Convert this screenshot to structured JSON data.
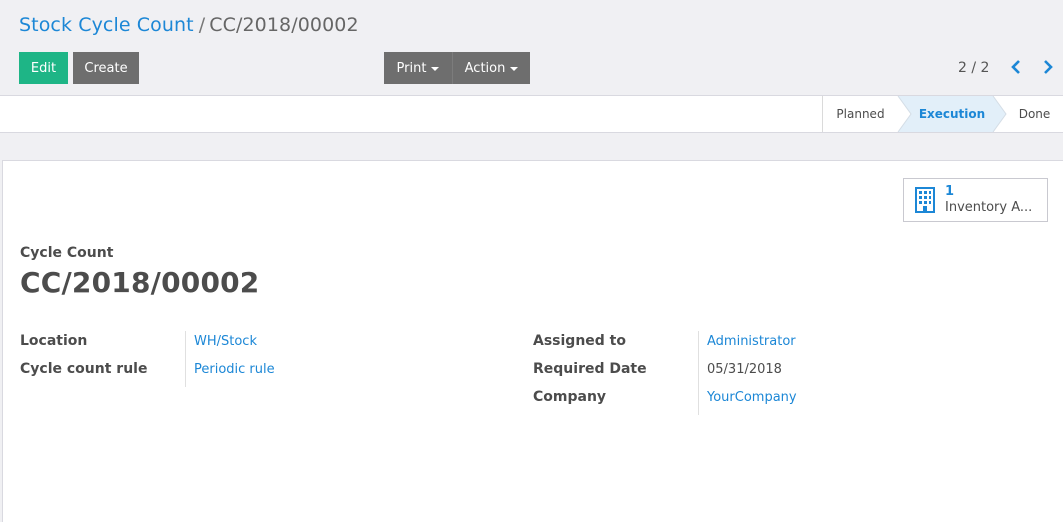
{
  "breadcrumb": {
    "parent": "Stock Cycle Count",
    "separator": "/",
    "current": "CC/2018/00002"
  },
  "toolbar": {
    "edit_label": "Edit",
    "create_label": "Create",
    "print_label": "Print",
    "action_label": "Action"
  },
  "pager": {
    "text": "2 / 2",
    "prev_icon": "chevron-left-icon",
    "next_icon": "chevron-right-icon"
  },
  "statusbar": {
    "stages": [
      "Planned",
      "Execution",
      "Done"
    ],
    "active": "Execution"
  },
  "smart_button": {
    "icon": "building-icon",
    "count": "1",
    "label": "Inventory A..."
  },
  "record": {
    "type_label": "Cycle Count",
    "name": "CC/2018/00002"
  },
  "fields": {
    "location_label": "Location",
    "location_value": "WH/Stock",
    "rule_label": "Cycle count rule",
    "rule_value": "Periodic rule",
    "assigned_label": "Assigned to",
    "assigned_value": "Administrator",
    "date_label": "Required Date",
    "date_value": "05/31/2018",
    "company_label": "Company",
    "company_value": "YourCompany"
  },
  "colors": {
    "accent": "#1c87d6",
    "primary_button": "#1eb586",
    "secondary_button": "#6e6e6e",
    "active_stage_bg": "#e2eff9"
  }
}
